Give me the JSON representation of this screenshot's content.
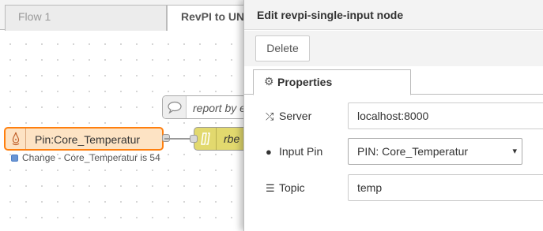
{
  "workspace": {
    "tabs": [
      {
        "label": "Flow 1"
      },
      {
        "label": "RevPI to UN"
      }
    ],
    "nodes": {
      "comment": {
        "label": "report by e"
      },
      "input": {
        "label": "Pin:Core_Temperatur",
        "status": "Change - Core_Temperatur is 54"
      },
      "rbe": {
        "label": "rbe"
      }
    }
  },
  "tray": {
    "title": "Edit revpi-single-input node",
    "delete_label": "Delete",
    "tab_label": "Properties",
    "fields": {
      "server": {
        "label": "Server",
        "value": "localhost:8000",
        "icon": "random-icon"
      },
      "input_pin": {
        "label": "Input Pin",
        "value": "PIN: Core_Temperatur",
        "icon": "circle-icon"
      },
      "topic": {
        "label": "Topic",
        "value": "temp",
        "icon": "tasks-icon"
      }
    }
  },
  "colors": {
    "input_node_fill": "#fde3c4",
    "input_node_border": "#ff7f0e",
    "rbe_node_fill": "#e2d96e",
    "status_dot": "#6a95d3"
  }
}
